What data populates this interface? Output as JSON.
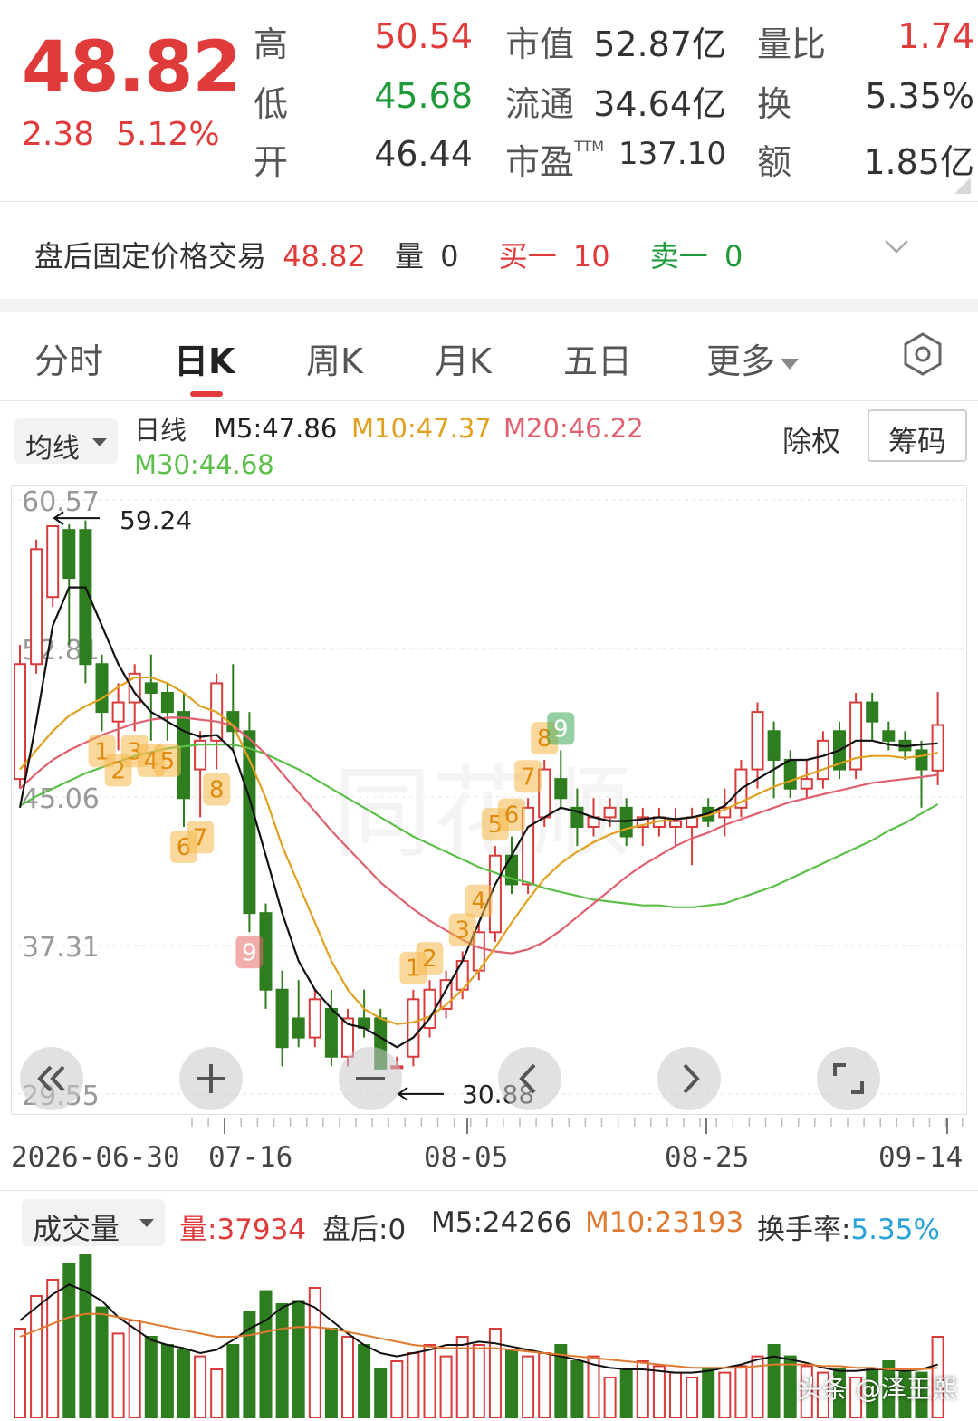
{
  "quote": {
    "price": "48.82",
    "change": "2.38",
    "change_pct": "5.12%",
    "rows": [
      {
        "l1": "高",
        "v1": "50.54",
        "c1": "red",
        "l2": "市值",
        "v2": "52.87亿",
        "l3": "量比",
        "v3": "1.74",
        "c3": "red"
      },
      {
        "l1": "低",
        "v1": "45.68",
        "c1": "green",
        "l2": "流通",
        "v2": "34.64亿",
        "l3": "换",
        "v3": "5.35%",
        "c3": "dark"
      },
      {
        "l1": "开",
        "v1": "46.44",
        "c1": "dark",
        "l2": "市盈",
        "l2sup": "TTM",
        "v2": "137.10",
        "l3": "额",
        "v3": "1.85亿",
        "c3": "dark"
      }
    ]
  },
  "after_hours": {
    "label": "盘后固定价格交易",
    "price": "48.82",
    "vol_label": "量",
    "vol": "0",
    "buy_label": "买一",
    "buy": "10",
    "sell_label": "卖一",
    "sell": "0"
  },
  "tabs": [
    "分时",
    "日K",
    "周K",
    "月K",
    "五日",
    "更多"
  ],
  "active_tab": "日K",
  "indicators": {
    "selector": "均线",
    "period": "日线",
    "m5": "M5:47.86",
    "m10": "M10:47.37",
    "m20": "M20:46.22",
    "m30": "M30:44.68",
    "fq": "除权",
    "chip": "筹码"
  },
  "chart_data": {
    "type": "candlestick",
    "y_ticks": [
      "60.57",
      "52.81",
      "45.06",
      "37.31",
      "29.55"
    ],
    "ylim": [
      29.55,
      60.57
    ],
    "x_ticks": [
      "2026-06-30",
      "07-16",
      "08-05",
      "08-25",
      "09-14"
    ],
    "high_marker": "59.24",
    "low_marker": "30.88",
    "colors": {
      "up": "#d93a3a",
      "down": "#2e7d1e",
      "m5": "#111111",
      "m10": "#e0a020",
      "m20": "#e06070",
      "m30": "#5cbf4a"
    },
    "candles": [
      [
        46.0,
        52.0,
        53.0,
        45.5
      ],
      [
        52.0,
        58.0,
        58.5,
        51.5
      ],
      [
        55.5,
        59.2,
        59.24,
        55.0
      ],
      [
        59.0,
        56.5,
        59.3,
        53.0
      ],
      [
        59.0,
        52.0,
        59.5,
        51.0
      ],
      [
        52.0,
        49.5,
        52.5,
        48.5
      ],
      [
        49.0,
        50.0,
        51.0,
        47.5
      ],
      [
        50.0,
        51.5,
        52.0,
        48.5
      ],
      [
        51.0,
        50.5,
        52.5,
        48.0
      ],
      [
        50.5,
        49.5,
        51.0,
        48.0
      ],
      [
        49.5,
        45.0,
        50.5,
        43.5
      ],
      [
        46.5,
        48.0,
        48.5,
        44.0
      ],
      [
        48.0,
        51.0,
        51.5,
        46.5
      ],
      [
        49.5,
        48.5,
        52.0,
        47.5
      ],
      [
        48.5,
        39.0,
        49.5,
        38.0
      ],
      [
        39.0,
        35.0,
        39.5,
        34.0
      ],
      [
        35.0,
        32.0,
        36.0,
        31.0
      ],
      [
        33.5,
        32.5,
        35.5,
        32.0
      ],
      [
        32.5,
        34.5,
        35.0,
        32.0
      ],
      [
        34.0,
        31.5,
        35.0,
        31.0
      ],
      [
        31.5,
        33.5,
        34.0,
        31.0
      ],
      [
        33.5,
        33.0,
        35.0,
        32.5
      ],
      [
        33.5,
        30.88,
        34.0,
        30.88
      ],
      [
        31.0,
        31.0,
        31.5,
        30.88
      ],
      [
        31.5,
        34.5,
        35.0,
        31.0
      ],
      [
        33.0,
        35.0,
        35.5,
        32.5
      ],
      [
        34.0,
        35.5,
        36.0,
        33.5
      ],
      [
        35.0,
        36.5,
        37.0,
        34.5
      ],
      [
        36.0,
        38.0,
        38.5,
        35.5
      ],
      [
        38.0,
        42.0,
        42.5,
        37.5
      ],
      [
        42.0,
        40.5,
        43.0,
        40.0
      ],
      [
        40.5,
        44.5,
        45.0,
        40.0
      ],
      [
        44.0,
        46.5,
        47.0,
        43.5
      ],
      [
        46.0,
        45.0,
        47.5,
        44.5
      ],
      [
        44.5,
        43.5,
        45.5,
        42.5
      ],
      [
        43.5,
        44.0,
        45.0,
        43.0
      ],
      [
        44.0,
        44.5,
        45.0,
        43.5
      ],
      [
        44.5,
        43.0,
        45.0,
        42.5
      ],
      [
        43.5,
        44.0,
        44.5,
        42.5
      ],
      [
        43.5,
        44.0,
        44.5,
        43.0
      ],
      [
        43.5,
        43.8,
        44.5,
        42.5
      ],
      [
        43.5,
        44.0,
        44.5,
        41.5
      ],
      [
        44.5,
        43.8,
        45.0,
        43.5
      ],
      [
        44.0,
        44.5,
        45.5,
        43.0
      ],
      [
        44.5,
        46.5,
        47.0,
        44.0
      ],
      [
        46.5,
        49.5,
        50.0,
        45.5
      ],
      [
        48.5,
        47.0,
        49.0,
        45.0
      ],
      [
        47.0,
        45.5,
        47.5,
        45.0
      ],
      [
        45.5,
        46.0,
        47.0,
        45.0
      ],
      [
        46.0,
        48.0,
        48.5,
        45.5
      ],
      [
        48.5,
        46.5,
        49.0,
        46.0
      ],
      [
        46.5,
        50.0,
        50.5,
        46.0
      ],
      [
        50.0,
        49.0,
        50.5,
        48.0
      ],
      [
        48.5,
        48.0,
        49.0,
        47.5
      ],
      [
        48.0,
        47.5,
        48.5,
        47.0
      ],
      [
        47.5,
        46.5,
        48.0,
        44.5
      ],
      [
        46.44,
        48.82,
        50.54,
        45.68
      ]
    ],
    "m5": [
      44.5,
      49.0,
      54.0,
      56.0,
      56.0,
      54.0,
      52.0,
      50.5,
      49.5,
      49.0,
      48.5,
      48.2,
      48.3,
      47.5,
      45.0,
      42.0,
      39.0,
      36.5,
      35.0,
      34.0,
      33.2,
      33.0,
      32.5,
      32.0,
      32.5,
      33.5,
      35.0,
      36.5,
      38.5,
      40.5,
      42.0,
      43.5,
      44.0,
      44.5,
      44.3,
      44.0,
      43.8,
      43.8,
      43.9,
      44.0,
      43.9,
      44.0,
      44.2,
      44.6,
      45.5,
      46.0,
      46.5,
      47.0,
      47.0,
      47.2,
      47.5,
      48.0,
      48.0,
      47.8,
      47.7,
      47.8,
      47.86
    ],
    "m10": [
      46.5,
      47.5,
      48.5,
      49.3,
      49.8,
      50.2,
      50.8,
      51.3,
      51.3,
      51.0,
      50.5,
      49.8,
      49.5,
      48.8,
      47.0,
      45.0,
      42.5,
      40.5,
      38.5,
      36.5,
      35.0,
      34.0,
      33.5,
      33.2,
      33.3,
      33.6,
      34.2,
      35.0,
      36.0,
      37.2,
      38.5,
      39.7,
      40.8,
      41.6,
      42.2,
      42.7,
      43.1,
      43.4,
      43.6,
      43.8,
      43.9,
      44.0,
      44.1,
      44.4,
      44.8,
      45.2,
      45.6,
      45.9,
      46.2,
      46.5,
      46.8,
      47.1,
      47.2,
      47.2,
      47.1,
      47.2,
      47.37
    ],
    "m20": [
      45.5,
      46.3,
      47.0,
      47.5,
      47.9,
      48.3,
      48.6,
      48.9,
      49.1,
      49.2,
      49.2,
      49.1,
      49.0,
      48.8,
      48.1,
      47.3,
      46.3,
      45.3,
      44.3,
      43.3,
      42.4,
      41.5,
      40.6,
      39.9,
      39.2,
      38.6,
      38.1,
      37.6,
      37.2,
      37.0,
      36.9,
      37.1,
      37.5,
      38.1,
      38.8,
      39.5,
      40.2,
      40.9,
      41.5,
      42.0,
      42.5,
      42.9,
      43.2,
      43.6,
      43.9,
      44.2,
      44.5,
      44.8,
      45.0,
      45.2,
      45.4,
      45.6,
      45.8,
      45.9,
      46.0,
      46.1,
      46.22
    ],
    "m30": [
      44.6,
      45.1,
      45.5,
      45.9,
      46.3,
      46.6,
      46.9,
      47.2,
      47.4,
      47.6,
      47.7,
      47.8,
      47.8,
      47.8,
      47.6,
      47.3,
      46.9,
      46.5,
      46.0,
      45.5,
      45.0,
      44.5,
      44.0,
      43.5,
      43.0,
      42.6,
      42.2,
      41.8,
      41.4,
      41.1,
      40.8,
      40.6,
      40.3,
      40.1,
      39.9,
      39.7,
      39.6,
      39.5,
      39.4,
      39.4,
      39.3,
      39.3,
      39.4,
      39.5,
      39.8,
      40.1,
      40.4,
      40.8,
      41.2,
      41.6,
      42.0,
      42.4,
      42.8,
      43.3,
      43.7,
      44.2,
      44.68
    ],
    "td_labels": [
      {
        "i": 5,
        "t": "1",
        "c": "y"
      },
      {
        "i": 6,
        "t": "2",
        "c": "y"
      },
      {
        "i": 7,
        "t": "3",
        "c": "y"
      },
      {
        "i": 8,
        "t": "4",
        "c": "y"
      },
      {
        "i": 9,
        "t": "5",
        "c": "y"
      },
      {
        "i": 10,
        "t": "6",
        "c": "y"
      },
      {
        "i": 11,
        "t": "7",
        "c": "y"
      },
      {
        "i": 12,
        "t": "8",
        "c": "y"
      },
      {
        "i": 14,
        "t": "9",
        "c": "r"
      },
      {
        "i": 24,
        "t": "1",
        "c": "y"
      },
      {
        "i": 25,
        "t": "2",
        "c": "y"
      },
      {
        "i": 27,
        "t": "3",
        "c": "y"
      },
      {
        "i": 28,
        "t": "4",
        "c": "y"
      },
      {
        "i": 29,
        "t": "5",
        "c": "y"
      },
      {
        "i": 30,
        "t": "6",
        "c": "y"
      },
      {
        "i": 31,
        "t": "7",
        "c": "y"
      },
      {
        "i": 32,
        "t": "8",
        "c": "y"
      },
      {
        "i": 33,
        "t": "9",
        "c": "g"
      }
    ],
    "watermark": "同花顺"
  },
  "volume": {
    "selector": "成交量",
    "vol": "量:37934",
    "after": "盘后:0",
    "m5": "M5:24266",
    "m10": "M10:23193",
    "turnover_label": "换手率:",
    "turnover": "5.35%",
    "bars": [
      0.55,
      0.75,
      0.85,
      0.95,
      1.0,
      0.68,
      0.52,
      0.6,
      0.5,
      0.45,
      0.42,
      0.38,
      0.3,
      0.45,
      0.65,
      0.78,
      0.7,
      0.72,
      0.8,
      0.55,
      0.5,
      0.45,
      0.3,
      0.35,
      0.4,
      0.45,
      0.38,
      0.5,
      0.45,
      0.55,
      0.42,
      0.38,
      0.4,
      0.45,
      0.35,
      0.38,
      0.25,
      0.3,
      0.35,
      0.32,
      0.28,
      0.25,
      0.3,
      0.28,
      0.32,
      0.38,
      0.45,
      0.38,
      0.32,
      0.28,
      0.3,
      0.25,
      0.3,
      0.35,
      0.3,
      0.28,
      0.5
    ],
    "m5_line": [
      0.6,
      0.68,
      0.76,
      0.82,
      0.78,
      0.72,
      0.62,
      0.55,
      0.48,
      0.45,
      0.43,
      0.4,
      0.42,
      0.48,
      0.55,
      0.6,
      0.68,
      0.72,
      0.68,
      0.6,
      0.52,
      0.45,
      0.4,
      0.38,
      0.4,
      0.42,
      0.45,
      0.45,
      0.47,
      0.46,
      0.44,
      0.42,
      0.4,
      0.38,
      0.36,
      0.33,
      0.31,
      0.3,
      0.3,
      0.29,
      0.28,
      0.28,
      0.29,
      0.31,
      0.33,
      0.36,
      0.38,
      0.36,
      0.34,
      0.31,
      0.29,
      0.29,
      0.3,
      0.3,
      0.29,
      0.3,
      0.33
    ],
    "m10_line": [
      0.5,
      0.54,
      0.58,
      0.62,
      0.64,
      0.64,
      0.62,
      0.6,
      0.58,
      0.56,
      0.54,
      0.52,
      0.5,
      0.5,
      0.51,
      0.53,
      0.55,
      0.56,
      0.56,
      0.55,
      0.53,
      0.51,
      0.49,
      0.47,
      0.45,
      0.44,
      0.43,
      0.43,
      0.43,
      0.43,
      0.42,
      0.41,
      0.4,
      0.39,
      0.38,
      0.37,
      0.36,
      0.35,
      0.34,
      0.33,
      0.32,
      0.31,
      0.31,
      0.31,
      0.31,
      0.32,
      0.33,
      0.33,
      0.33,
      0.32,
      0.32,
      0.31,
      0.31,
      0.3,
      0.3,
      0.3,
      0.31
    ]
  },
  "watermark_text": "头条 @泽王熙"
}
